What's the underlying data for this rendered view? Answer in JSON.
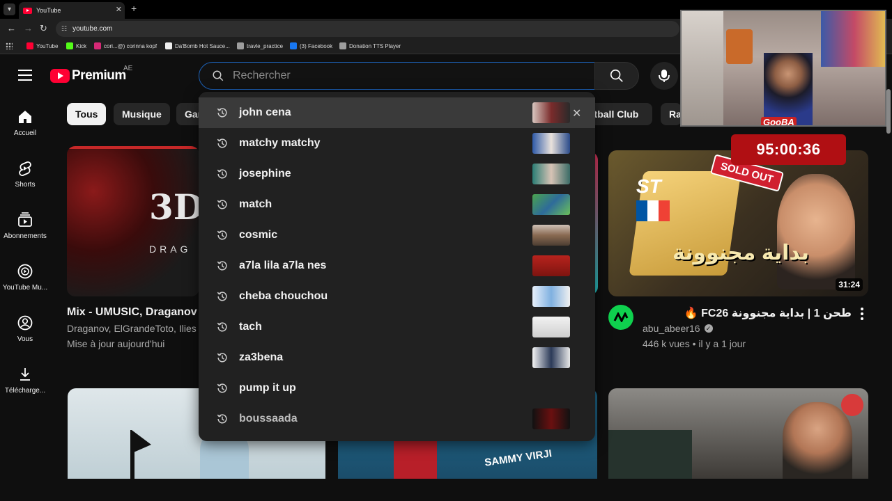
{
  "browser": {
    "tab_title": "YouTube",
    "new_tab": "+",
    "url": "youtube.com",
    "bookmarks": [
      {
        "label": "YouTube",
        "color": "#ff0033"
      },
      {
        "label": "Kick",
        "color": "#53fc18"
      },
      {
        "label": "cori...@) corinna kopf",
        "color": "#d62976"
      },
      {
        "label": "Da'Bomb Hot Sauce...",
        "color": "#eeeeee"
      },
      {
        "label": "travle_practice",
        "color": "#9e9e9e"
      },
      {
        "label": "(3) Facebook",
        "color": "#1877f2"
      },
      {
        "label": "Donation TTS Player",
        "color": "#9e9e9e"
      }
    ]
  },
  "masthead": {
    "logo_text": "Premium",
    "country_code": "AE",
    "search_placeholder": "Rechercher"
  },
  "guide": [
    {
      "label": "Accueil",
      "icon": "home-icon"
    },
    {
      "label": "Shorts",
      "icon": "shorts-icon"
    },
    {
      "label": "Abonnements",
      "icon": "subscriptions-icon"
    },
    {
      "label": "YouTube Mu...",
      "icon": "youtube-music-icon"
    },
    {
      "label": "Vous",
      "icon": "you-icon"
    },
    {
      "label": "Télécharge...",
      "icon": "download-icon"
    }
  ],
  "chips": [
    "Tous",
    "Musique",
    "Gar",
    "otball Club",
    "Ra"
  ],
  "suggestions": [
    "john cena",
    "matchy matchy",
    "josephine",
    "match",
    "cosmic",
    "a7la lila a7la nes",
    "cheba chouchou",
    "tach",
    "za3bena",
    "pump it up",
    "boussaada"
  ],
  "videos": {
    "left_top": {
      "title": "Mix - UMUSIC, Draganov -",
      "meta1": "Draganov, ElGrandeToto, Ilies T",
      "meta2": "Mise à jour aujourd'hui",
      "thumb_text": "3D",
      "thumb_sub": "DRAG"
    },
    "right_top": {
      "title": "طحن 1 | بداية مجنوونة FC26 🔥",
      "channel": "abu_abeer16",
      "meta": "446 k vues • il y a 1 jour",
      "duration": "31:24",
      "thumb_badge": "SOLD OUT",
      "thumb_card": "ST",
      "thumb_arabic": "بداية مجنوونة"
    },
    "middle_bottom": {
      "thumb_text": "SAMMY VIRJI"
    }
  },
  "overlay": {
    "timer": "95:00:36",
    "cam_name": "GooBA"
  }
}
